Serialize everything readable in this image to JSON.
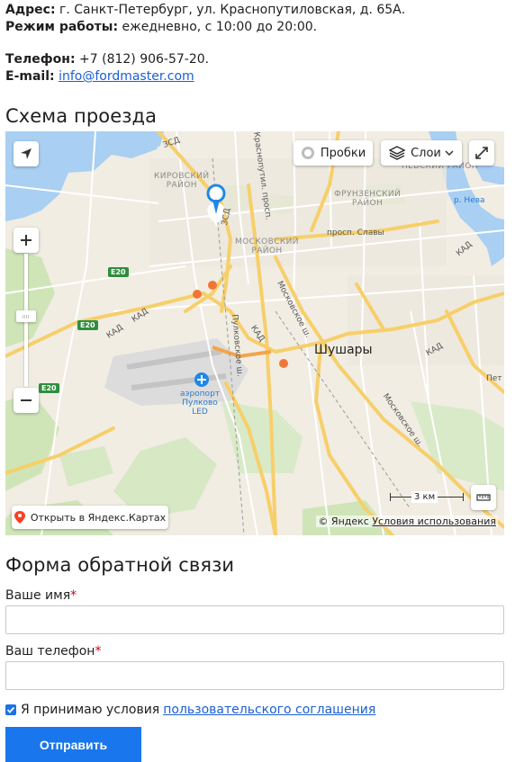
{
  "contacts": {
    "address_label": "Адрес:",
    "address_value": " г. Санкт-Петербург, ул. Краснопутиловская, д. 65А.",
    "hours_label": "Режим работы:",
    "hours_value": " ежедневно, с 10:00 до 20:00.",
    "phone_label": "Телефон:",
    "phone_value": " +7 (812) 906-57-20.",
    "email_label": "E-mail:",
    "email_value": "info@fordmaster.com"
  },
  "map_section": {
    "title": "Схема проезда",
    "traffic_button": "Пробки",
    "layers_button": "Слои",
    "open_in_yandex": "Открыть в Яндекс.Картах",
    "scale_label": "3 км",
    "copyright": "© Яндекс",
    "terms_link": "Условия использования",
    "labels": {
      "kirovsky": "КИРОВСКИЙ\nРАЙОН",
      "frunzensky": "ФРУНЗЕНСКИЙ\nРАЙОН",
      "moskovsky": "МОСКОВСКИЙ\nРАЙОН",
      "nevsky": "НЕВСКИЙ РАЙОН",
      "shushary": "Шушары",
      "airport": "аэропорт\nПулково\nLED",
      "neva": "р. Нева",
      "slavy": "просп. Славы",
      "pulkovskoe": "Пулковское ш.",
      "moskovskoe": "Московское ш.",
      "kad": "КАД",
      "zsd": "ЗСД",
      "e20": "E20",
      "kr_prosp": "Краснопутил. просп.",
      "pet": "Пет"
    }
  },
  "form": {
    "title": "Форма обратной связи",
    "name_label": "Ваше имя",
    "phone_label": "Ваш телефон",
    "required_mark": "*",
    "agree_text": "Я принимаю условия",
    "agree_link": "пользовательского соглашения",
    "submit_label": "Отправить",
    "agree_checked": true
  },
  "colors": {
    "link": "#1a5fd6",
    "submit_bg": "#1976ec",
    "required": "#d0021b",
    "marker": "#1e88e5"
  }
}
